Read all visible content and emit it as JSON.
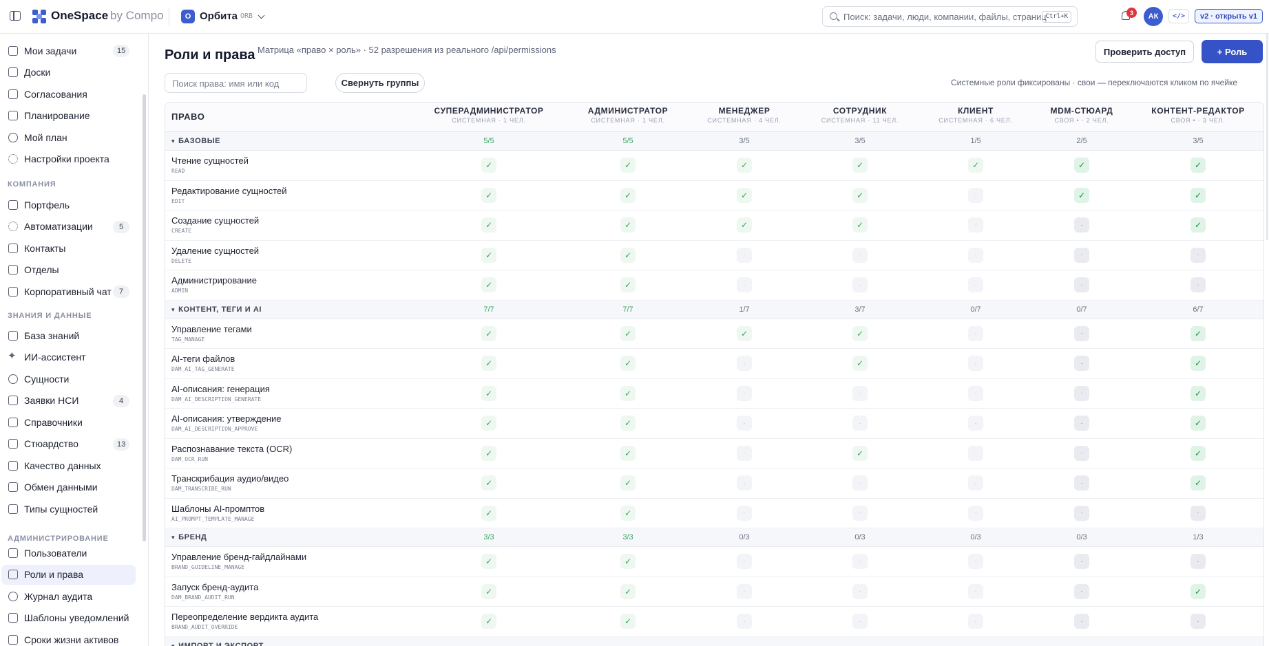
{
  "topbar": {
    "brand": "OneSpace",
    "brand_by": "by Compo",
    "workspace_badge": "О",
    "workspace_name": "Орбита",
    "workspace_code": "ORB",
    "search_placeholder": "Поиск: задачи, люди, компании, файлы, страниц",
    "search_shortcut": "Ctrl+K",
    "notification_count": "3",
    "avatar_initials": "АК",
    "code_button": "</>",
    "version_button": "v2 · открыть v1"
  },
  "sidebar": {
    "items_top": [
      {
        "label": "Мои задачи",
        "badge": "15",
        "icon": "check-shield-icon"
      },
      {
        "label": "Доски",
        "badge": "",
        "icon": "board-icon"
      },
      {
        "label": "Согласования",
        "badge": "",
        "icon": "check-shield-icon"
      },
      {
        "label": "Планирование",
        "badge": "",
        "icon": "calendar-icon"
      },
      {
        "label": "Мой план",
        "badge": "",
        "icon": "clock-icon"
      },
      {
        "label": "Настройки проекта",
        "badge": "",
        "icon": "settings-icon"
      }
    ],
    "section_company": "КОМПАНИЯ",
    "items_company": [
      {
        "label": "Портфель",
        "badge": "",
        "icon": "calendar-icon"
      },
      {
        "label": "Автоматизации",
        "badge": "5",
        "icon": "settings-icon"
      },
      {
        "label": "Контакты",
        "badge": "",
        "icon": "people-icon"
      },
      {
        "label": "Отделы",
        "badge": "",
        "icon": "folder-icon"
      },
      {
        "label": "Корпоративный чат",
        "badge": "7",
        "icon": "chat-icon"
      }
    ],
    "section_knowledge": "ЗНАНИЯ И ДАННЫЕ",
    "items_knowledge": [
      {
        "label": "База знаний",
        "badge": "",
        "icon": "book-icon"
      },
      {
        "label": "ИИ-ассистент",
        "badge": "",
        "icon": "sparkle-icon"
      },
      {
        "label": "Сущности",
        "badge": "",
        "icon": "database-icon"
      },
      {
        "label": "Заявки НСИ",
        "badge": "4",
        "icon": "check-shield-icon"
      },
      {
        "label": "Справочники",
        "badge": "",
        "icon": "folder-icon"
      },
      {
        "label": "Стюардство",
        "badge": "13",
        "icon": "check-shield-icon"
      },
      {
        "label": "Качество данных",
        "badge": "",
        "icon": "check-shield-icon"
      },
      {
        "label": "Обмен данными",
        "badge": "",
        "icon": "calendar-icon"
      },
      {
        "label": "Типы сущностей",
        "badge": "",
        "icon": "grid-icon"
      }
    ],
    "section_admin": "АДМИНИСТРИРОВАНИЕ",
    "items_admin": [
      {
        "label": "Пользователи",
        "badge": "",
        "icon": "people-icon"
      },
      {
        "label": "Роли и права",
        "badge": "",
        "icon": "check-shield-icon"
      },
      {
        "label": "Журнал аудита",
        "badge": "",
        "icon": "clock-icon"
      },
      {
        "label": "Шаблоны уведомлений",
        "badge": "",
        "icon": "bell-icon"
      },
      {
        "label": "Сроки жизни активов",
        "badge": "",
        "icon": "calendar-icon"
      }
    ]
  },
  "main": {
    "title": "Роли и права",
    "subtitle": "Матрица «право × роль» · 52 разрешения из реального /api/permissions",
    "check_access_button": "Проверить доступ",
    "add_role_button": "+ Роль",
    "filter_placeholder": "Поиск права: имя или код",
    "collapse_button": "Свернуть группы",
    "hint": "Системные роли фиксированы · свои — переключаются кликом по ячейке"
  },
  "table": {
    "right_header": "ПРАВО",
    "roles": [
      {
        "name": "СУПЕРАДМИНИСТРАТОР",
        "meta": "СИСТЕМНАЯ · 1 ЧЕЛ."
      },
      {
        "name": "АДМИНИСТРАТОР",
        "meta": "СИСТЕМНАЯ · 1 ЧЕЛ."
      },
      {
        "name": "МЕНЕДЖЕР",
        "meta": "СИСТЕМНАЯ · 4 ЧЕЛ."
      },
      {
        "name": "СОТРУДНИК",
        "meta": "СИСТЕМНАЯ · 11 ЧЕЛ."
      },
      {
        "name": "КЛИЕНТ",
        "meta": "СИСТЕМНАЯ · 6 ЧЕЛ."
      },
      {
        "name": "MDM-СТЮАРД",
        "meta": "СВОЯ • · 2 ЧЕЛ."
      },
      {
        "name": "КОНТЕНТ-РЕДАКТОР",
        "meta": "СВОЯ • · 3 ЧЕЛ."
      }
    ],
    "custom_roles": [
      false,
      false,
      false,
      false,
      false,
      true,
      true
    ],
    "groups": [
      {
        "name": "БАЗОВЫЕ",
        "counts": [
          "5/5",
          "5/5",
          "3/5",
          "3/5",
          "1/5",
          "2/5",
          "3/5"
        ],
        "rows": [
          {
            "label": "Чтение сущностей",
            "code": "READ",
            "grants": [
              1,
              1,
              1,
              1,
              1,
              1,
              1
            ]
          },
          {
            "label": "Редактирование сущностей",
            "code": "EDIT",
            "grants": [
              1,
              1,
              1,
              1,
              0,
              1,
              1
            ]
          },
          {
            "label": "Создание сущностей",
            "code": "CREATE",
            "grants": [
              1,
              1,
              1,
              1,
              0,
              0,
              1
            ]
          },
          {
            "label": "Удаление сущностей",
            "code": "DELETE",
            "grants": [
              1,
              1,
              0,
              0,
              0,
              0,
              0
            ]
          },
          {
            "label": "Администрирование",
            "code": "ADMIN",
            "grants": [
              1,
              1,
              0,
              0,
              0,
              0,
              0
            ]
          }
        ]
      },
      {
        "name": "КОНТЕНТ, ТЕГИ И AI",
        "counts": [
          "7/7",
          "7/7",
          "1/7",
          "3/7",
          "0/7",
          "0/7",
          "6/7"
        ],
        "rows": [
          {
            "label": "Управление тегами",
            "code": "TAG_MANAGE",
            "grants": [
              1,
              1,
              1,
              1,
              0,
              0,
              1
            ]
          },
          {
            "label": "AI-теги файлов",
            "code": "DAM_AI_TAG_GENERATE",
            "grants": [
              1,
              1,
              0,
              1,
              0,
              0,
              1
            ]
          },
          {
            "label": "AI-описания: генерация",
            "code": "DAM_AI_DESCRIPTION_GENERATE",
            "grants": [
              1,
              1,
              0,
              0,
              0,
              0,
              1
            ]
          },
          {
            "label": "AI-описания: утверждение",
            "code": "DAM_AI_DESCRIPTION_APPROVE",
            "grants": [
              1,
              1,
              0,
              0,
              0,
              0,
              1
            ]
          },
          {
            "label": "Распознавание текста (OCR)",
            "code": "DAM_OCR_RUN",
            "grants": [
              1,
              1,
              0,
              1,
              0,
              0,
              1
            ]
          },
          {
            "label": "Транскрибация аудио/видео",
            "code": "DAM_TRANSCRIBE_RUN",
            "grants": [
              1,
              1,
              0,
              0,
              0,
              0,
              1
            ]
          },
          {
            "label": "Шаблоны AI-промптов",
            "code": "AI_PROMPT_TEMPLATE_MANAGE",
            "grants": [
              1,
              1,
              0,
              0,
              0,
              0,
              0
            ]
          }
        ]
      },
      {
        "name": "БРЕНД",
        "counts": [
          "3/3",
          "3/3",
          "0/3",
          "0/3",
          "0/3",
          "0/3",
          "1/3"
        ],
        "rows": [
          {
            "label": "Управление бренд-гайдлайнами",
            "code": "BRAND_GUIDELINE_MANAGE",
            "grants": [
              1,
              1,
              0,
              0,
              0,
              0,
              0
            ]
          },
          {
            "label": "Запуск бренд-аудита",
            "code": "DAM_BRAND_AUDIT_RUN",
            "grants": [
              1,
              1,
              0,
              0,
              0,
              0,
              1
            ]
          },
          {
            "label": "Переопределение вердикта аудита",
            "code": "BRAND_AUDIT_OVERRIDE",
            "grants": [
              1,
              1,
              0,
              0,
              0,
              0,
              0
            ]
          }
        ]
      },
      {
        "name": "ИМПОРТ И ЭКСПОРТ",
        "counts": [
          "",
          "",
          "",
          "",
          "",
          "",
          ""
        ],
        "rows": []
      }
    ]
  }
}
